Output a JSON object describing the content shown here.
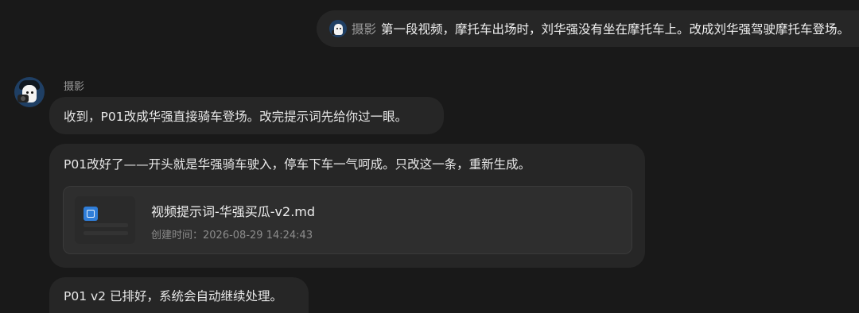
{
  "user_message": {
    "agent_tag": "摄影",
    "text": "第一段视频，摩托车出场时，刘华强没有坐在摩托车上。改成刘华强驾驶摩托车登场。"
  },
  "assistant": {
    "name": "摄影",
    "messages": [
      "收到，P01改成华强直接骑车登场。改完提示词先给你过一眼。",
      "P01改好了——开头就是华强骑车驶入，停车下车一气呵成。只改这一条，重新生成。",
      "P01 v2 已排好，系统会自动继续处理。"
    ],
    "file_card": {
      "name": "视频提示词-华强买瓜-v2.md",
      "created_label": "创建时间：",
      "created_at": "2026-08-29 14:24:43"
    }
  },
  "colors": {
    "background": "#191919",
    "bubble": "#262626",
    "card": "#2e2e2e",
    "avatar_bg": "#1f3f64",
    "doc_icon": "#2f7dd8"
  }
}
